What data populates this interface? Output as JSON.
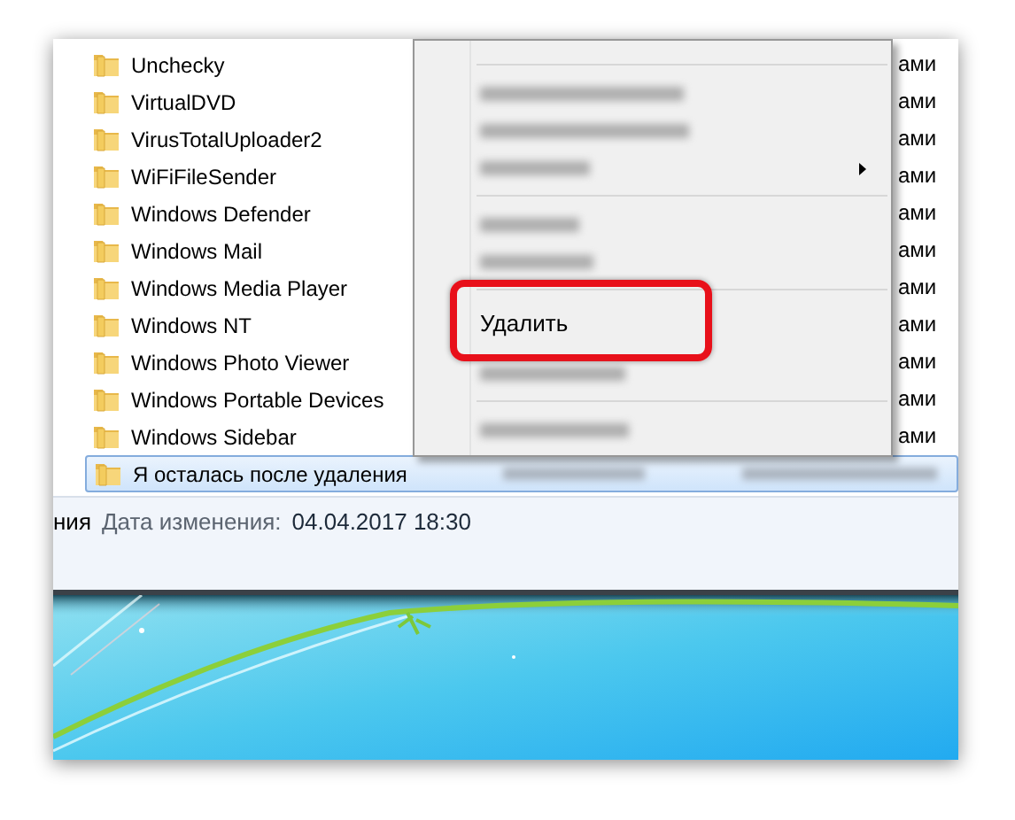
{
  "files": [
    {
      "name": "Unchecky",
      "type": "ами",
      "selected": false
    },
    {
      "name": "VirtualDVD",
      "type": "ами",
      "selected": false
    },
    {
      "name": "VirusTotalUploader2",
      "type": "ами",
      "selected": false
    },
    {
      "name": "WiFiFileSender",
      "type": "ами",
      "selected": false
    },
    {
      "name": "Windows Defender",
      "type": "ами",
      "selected": false
    },
    {
      "name": "Windows Mail",
      "type": "ами",
      "selected": false
    },
    {
      "name": "Windows Media Player",
      "type": "ами",
      "selected": false
    },
    {
      "name": "Windows NT",
      "type": "ами",
      "selected": false
    },
    {
      "name": "Windows Photo Viewer",
      "type": "ами",
      "selected": false
    },
    {
      "name": "Windows Portable Devices",
      "type": "ами",
      "selected": false
    },
    {
      "name": "Windows Sidebar",
      "type": "ами",
      "selected": false
    },
    {
      "name": "Я осталась после удаления",
      "selected": true
    }
  ],
  "context_menu": {
    "items": [
      {
        "kind": "separator"
      },
      {
        "kind": "blurred",
        "submenu": false
      },
      {
        "kind": "blurred",
        "submenu": false
      },
      {
        "kind": "blurred",
        "submenu": true
      },
      {
        "kind": "separator"
      },
      {
        "kind": "blurred",
        "submenu": false
      },
      {
        "kind": "blurred",
        "submenu": false
      },
      {
        "kind": "separator"
      },
      {
        "kind": "item",
        "label": "Удалить",
        "highlighted": true
      },
      {
        "kind": "blurred",
        "submenu": false
      },
      {
        "kind": "separator"
      },
      {
        "kind": "blurred",
        "submenu": false
      }
    ]
  },
  "details": {
    "name_fragment": "ния",
    "label": "Дата изменения:",
    "value": "04.04.2017 18:30"
  }
}
